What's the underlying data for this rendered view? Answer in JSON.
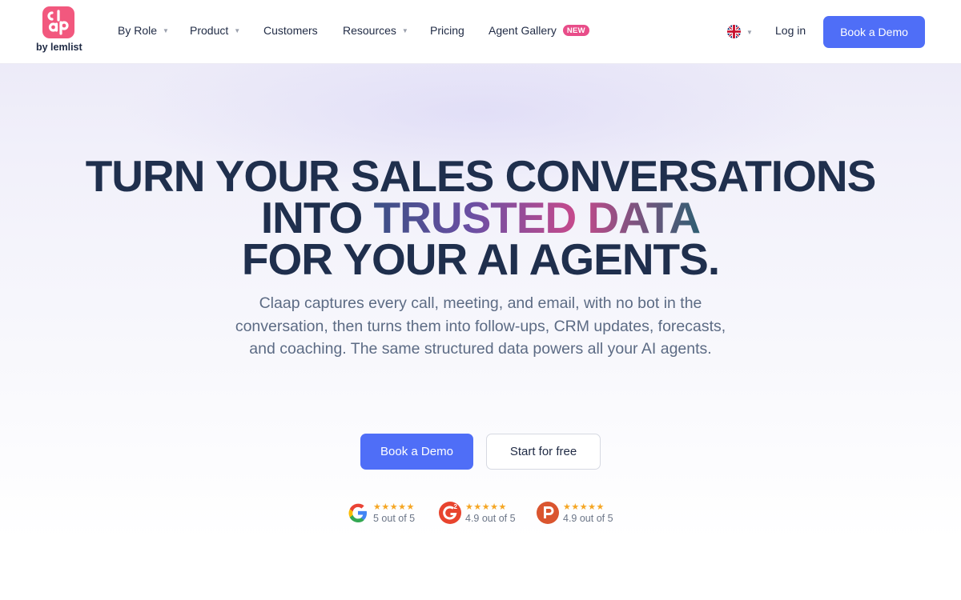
{
  "nav": {
    "logo_sub": "by lemlist",
    "items": [
      {
        "label": "By Role",
        "dropdown": true
      },
      {
        "label": "Product",
        "dropdown": true
      },
      {
        "label": "Customers",
        "dropdown": false
      },
      {
        "label": "Resources",
        "dropdown": true
      },
      {
        "label": "Pricing",
        "dropdown": false
      },
      {
        "label": "Agent Gallery",
        "dropdown": false,
        "badge": "NEW"
      }
    ],
    "language_icon": "uk-flag-icon",
    "login_label": "Log in",
    "demo_label": "Book a Demo"
  },
  "hero": {
    "line1": "TURN YOUR SALES CONVERSATIONS",
    "line2_plain": "INTO",
    "line2_highlight": "TRUSTED DATA",
    "line3": "FOR YOUR AI AGENTS.",
    "subtitle": "Claap captures every call, meeting, and email, with no bot in the conversation, then turns them into follow-ups, CRM updates, forecasts, and coaching. The same structured data powers all your AI agents.",
    "cta_primary": "Book a Demo",
    "cta_secondary": "Start for free"
  },
  "ratings": [
    {
      "source_icon": "google-icon",
      "stars": "★★★★★",
      "score": "5 out of 5"
    },
    {
      "source_icon": "g2-icon",
      "stars": "★★★★★",
      "score": "4.9 out of 5"
    },
    {
      "source_icon": "producthunt-icon",
      "stars": "★★★★★",
      "score": "4.9 out of 5"
    }
  ],
  "colors": {
    "brand_blue": "#4f6ef7",
    "logo_pink": "#f2587e",
    "badge_pink": "#e84d89",
    "heading": "#1f2f4d",
    "star": "#f5a623"
  }
}
